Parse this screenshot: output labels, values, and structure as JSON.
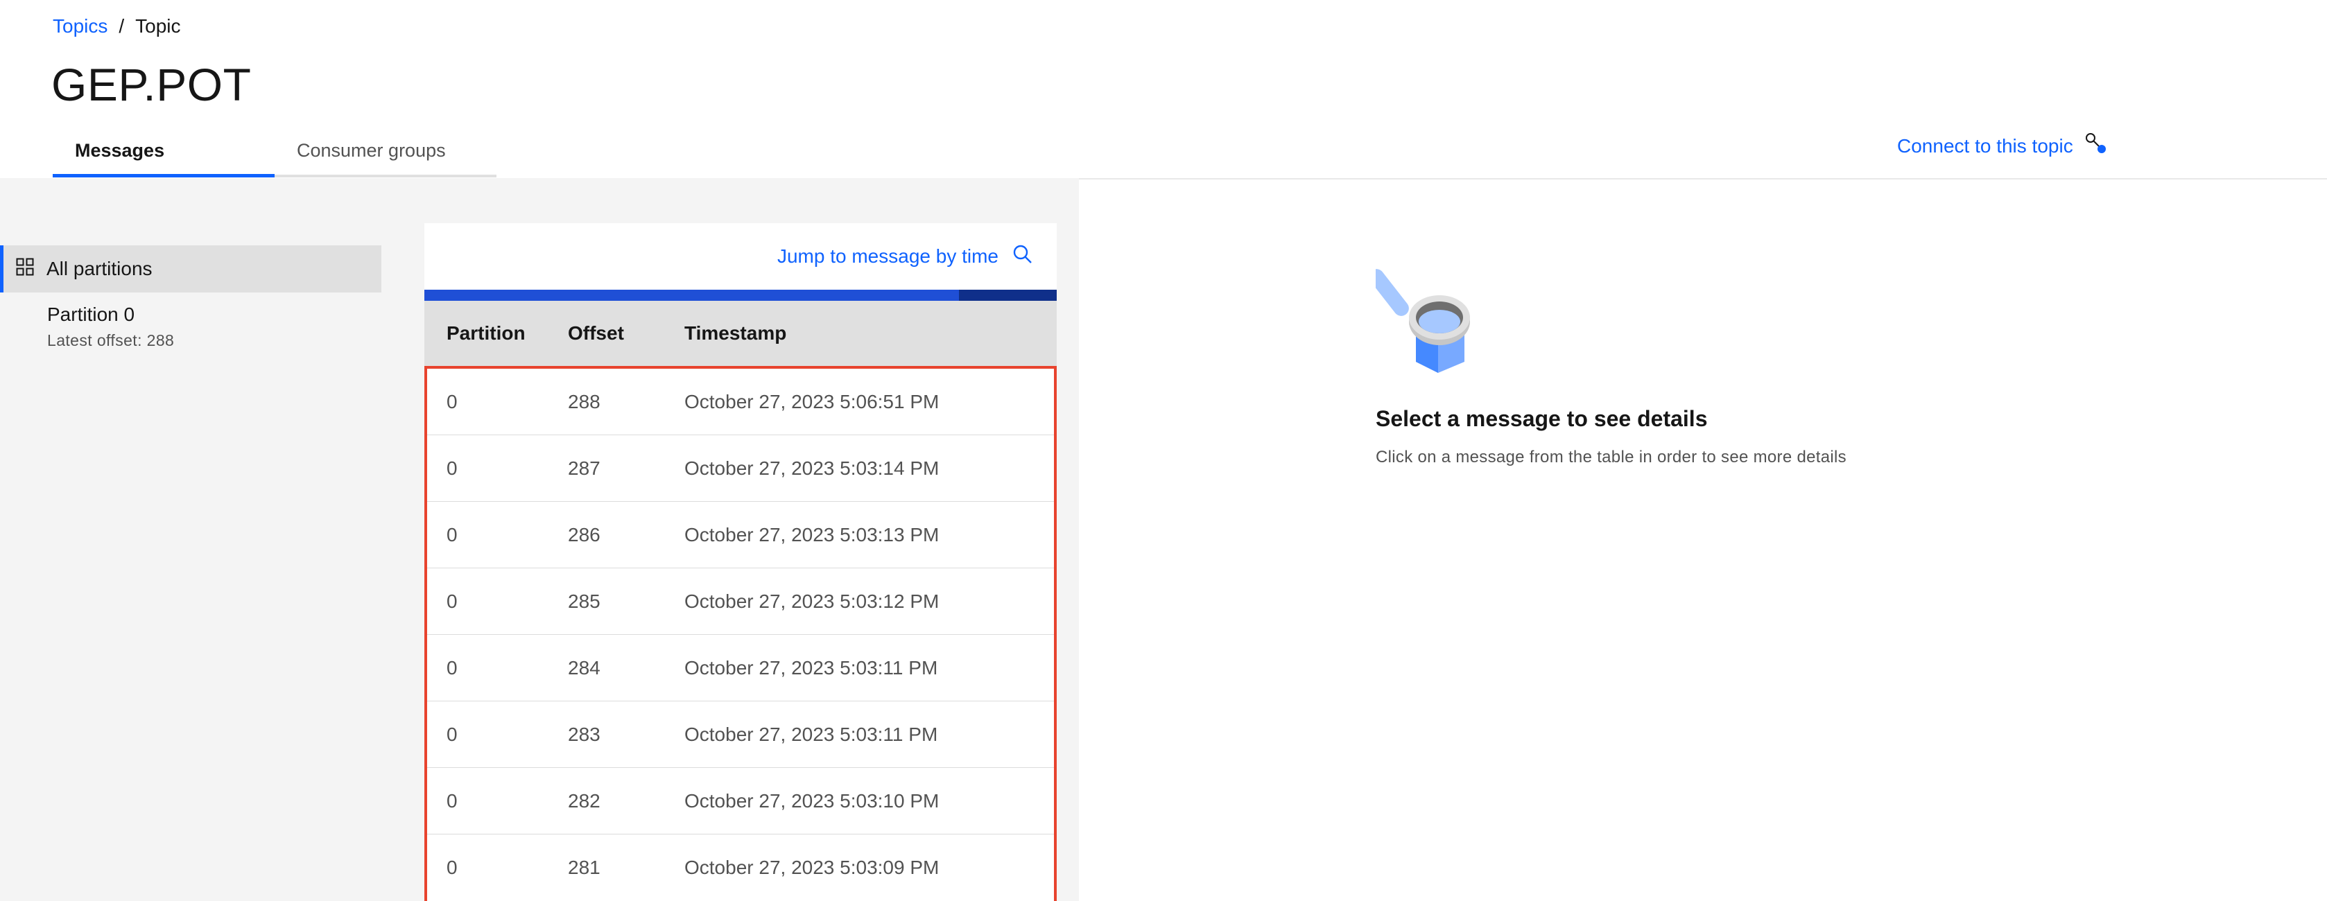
{
  "breadcrumb": {
    "root": "Topics",
    "separator": "/",
    "current": "Topic"
  },
  "page_title": "GEP.POT",
  "tabs": [
    {
      "label": "Messages",
      "active": true
    },
    {
      "label": "Consumer groups",
      "active": false
    }
  ],
  "connect_link": {
    "label": "Connect to this topic",
    "icon": "connect-icon"
  },
  "sidebar": {
    "all_partitions": {
      "label": "All partitions",
      "icon": "grid-icon"
    },
    "partition0": {
      "label": "Partition 0",
      "sub": "Latest offset: 288"
    }
  },
  "table": {
    "jump_label": "Jump to message by time",
    "jump_icon": "search-icon",
    "headers": {
      "partition": "Partition",
      "offset": "Offset",
      "timestamp": "Timestamp"
    },
    "rows": [
      {
        "partition": "0",
        "offset": "288",
        "timestamp": "October 27, 2023 5:06:51 PM"
      },
      {
        "partition": "0",
        "offset": "287",
        "timestamp": "October 27, 2023 5:03:14 PM"
      },
      {
        "partition": "0",
        "offset": "286",
        "timestamp": "October 27, 2023 5:03:13 PM"
      },
      {
        "partition": "0",
        "offset": "285",
        "timestamp": "October 27, 2023 5:03:12 PM"
      },
      {
        "partition": "0",
        "offset": "284",
        "timestamp": "October 27, 2023 5:03:11 PM"
      },
      {
        "partition": "0",
        "offset": "283",
        "timestamp": "October 27, 2023 5:03:11 PM"
      },
      {
        "partition": "0",
        "offset": "282",
        "timestamp": "October 27, 2023 5:03:10 PM"
      },
      {
        "partition": "0",
        "offset": "281",
        "timestamp": "October 27, 2023 5:03:09 PM"
      }
    ]
  },
  "empty_state": {
    "title": "Select a message to see details",
    "description": "Click on a message from the table in order to see more details",
    "icon": "magnifier-illustration"
  },
  "colors": {
    "accent": "#0f62fe",
    "highlight_border": "#e8432e",
    "panel_bg": "#f4f4f4"
  }
}
